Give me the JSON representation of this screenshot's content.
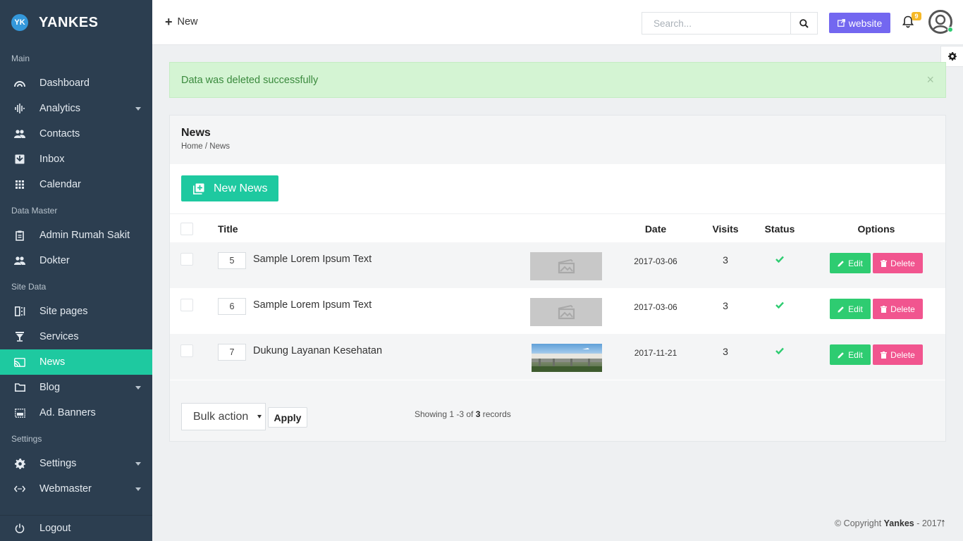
{
  "brand": {
    "logo_text": "YK",
    "name": "YANKES"
  },
  "sidebar": {
    "sections": [
      {
        "label": "Main",
        "items": [
          {
            "label": "Dashboard",
            "icon": "dashboard-icon",
            "has_submenu": false
          },
          {
            "label": "Analytics",
            "icon": "analytics-icon",
            "has_submenu": true
          },
          {
            "label": "Contacts",
            "icon": "contacts-icon",
            "has_submenu": false
          },
          {
            "label": "Inbox",
            "icon": "inbox-icon",
            "has_submenu": false
          },
          {
            "label": "Calendar",
            "icon": "calendar-icon",
            "has_submenu": false
          }
        ]
      },
      {
        "label": "Data Master",
        "items": [
          {
            "label": "Admin Rumah Sakit",
            "icon": "clipboard-icon",
            "has_submenu": false
          },
          {
            "label": "Dokter",
            "icon": "people-icon",
            "has_submenu": false
          }
        ]
      },
      {
        "label": "Site Data",
        "items": [
          {
            "label": "Site pages",
            "icon": "pages-icon",
            "has_submenu": false
          },
          {
            "label": "Services",
            "icon": "filter-icon",
            "has_submenu": false
          },
          {
            "label": "News",
            "icon": "rss-icon",
            "has_submenu": false,
            "active": true
          },
          {
            "label": "Blog",
            "icon": "folder-icon",
            "has_submenu": true
          },
          {
            "label": "Ad. Banners",
            "icon": "banner-icon",
            "has_submenu": false
          }
        ]
      },
      {
        "label": "Settings",
        "items": [
          {
            "label": "Settings",
            "icon": "gear-icon",
            "has_submenu": true
          },
          {
            "label": "Webmaster",
            "icon": "code-icon",
            "has_submenu": true
          }
        ]
      }
    ],
    "logout_label": "Logout"
  },
  "topbar": {
    "new_label": "New",
    "search_placeholder": "Search...",
    "website_label": "website",
    "notification_count": "9"
  },
  "alert": {
    "message": "Data was deleted successfully",
    "close_symbol": "×"
  },
  "panel": {
    "title": "News",
    "breadcrumb": "Home / News",
    "new_button_label": "New News",
    "columns": {
      "title": "Title",
      "date": "Date",
      "visits": "Visits",
      "status": "Status",
      "options": "Options"
    },
    "rows": [
      {
        "order": "5",
        "title": "Sample Lorem Ipsum Text",
        "thumbnail": "placeholder",
        "date": "2017-03-06",
        "visits": "3",
        "status": "active"
      },
      {
        "order": "6",
        "title": "Sample Lorem Ipsum Text",
        "thumbnail": "placeholder",
        "date": "2017-03-06",
        "visits": "3",
        "status": "active"
      },
      {
        "order": "7",
        "title": "Dukung Layanan Kesehatan",
        "thumbnail": "photo",
        "date": "2017-11-21",
        "visits": "3",
        "status": "active"
      }
    ],
    "edit_label": "Edit",
    "delete_label": "Delete",
    "bulk_action_label": "Bulk action",
    "apply_label": "Apply",
    "showing_prefix": "Showing 1 -3 of ",
    "showing_total": "3",
    "showing_suffix": " records"
  },
  "footer": {
    "copyright_prefix": "© Copyright ",
    "copyright_brand": "Yankes",
    "copyright_suffix": " - 2017",
    "to_top_symbol": "↑"
  },
  "colors": {
    "sidebar_bg": "#2c3e50",
    "accent": "#1ec9a0",
    "website_btn": "#7367f0",
    "edit_btn": "#2ecc71",
    "delete_btn": "#f1558f",
    "badge": "#f6b928",
    "alert_bg": "#d4f4d3"
  }
}
